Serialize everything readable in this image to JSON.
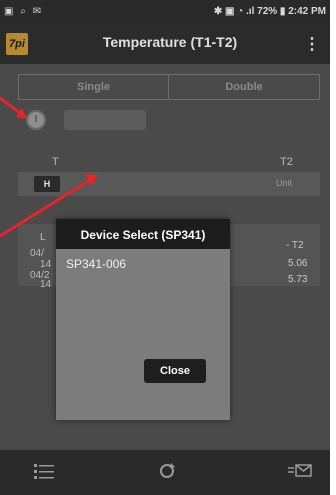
{
  "status_bar": {
    "left_icons": "▣ ⌕ ✉",
    "right_text": "✱ ▣ ◔ .ıl 72% ▮ 2:42 PM"
  },
  "app_bar": {
    "logo_text": "7pi",
    "title": "Temperature (T1-T2)",
    "menu_icon": "⋮"
  },
  "mode_tabs": {
    "single_label": "Single",
    "double_label": "Double"
  },
  "device_radio": {
    "label": "I"
  },
  "columns": {
    "t1": "T",
    "t2": "T2"
  },
  "hold_button": {
    "label": "H"
  },
  "unit_label": "Unit",
  "table": {
    "row_tags": [
      "L",
      "04/",
      "14",
      "04/2",
      "14"
    ],
    "right_cells": [
      "- T2",
      "5.06",
      "5.73"
    ]
  },
  "dialog": {
    "title": "Device Select (SP341)",
    "items": [
      "SP341-006"
    ],
    "close_label": "Close"
  },
  "bottom_bar": {
    "list_icon": "list-icon",
    "refresh_icon": "refresh-icon",
    "mail_icon": "mail-icon"
  },
  "annotation_color": "#e8232a"
}
